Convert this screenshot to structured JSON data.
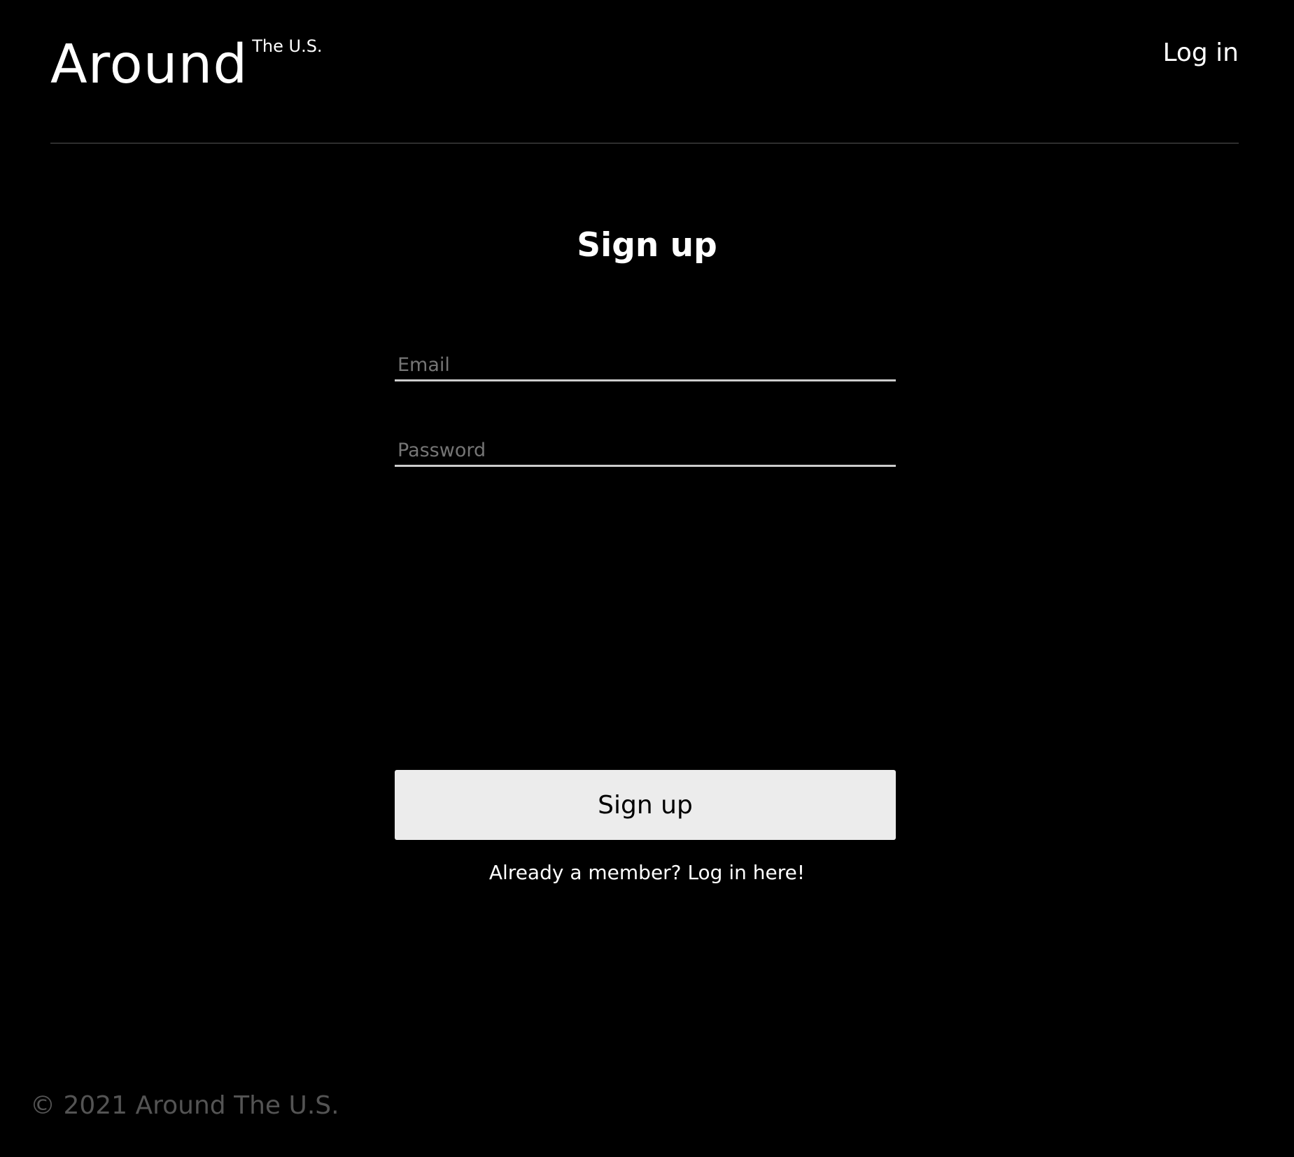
{
  "header": {
    "logo_main": "Around",
    "logo_sup": "The U.S.",
    "login_link": "Log in"
  },
  "form": {
    "title": "Sign up",
    "email_placeholder": "Email",
    "password_placeholder": "Password",
    "submit_label": "Sign up",
    "alt_link": "Already a member? Log in here!"
  },
  "footer": {
    "copyright": "© 2021 Around The U.S."
  },
  "colors": {
    "background": "#000000",
    "text": "#ffffff",
    "button_bg": "#ececec",
    "placeholder": "#757575",
    "footer_text": "#545454",
    "divider": "#545454"
  }
}
